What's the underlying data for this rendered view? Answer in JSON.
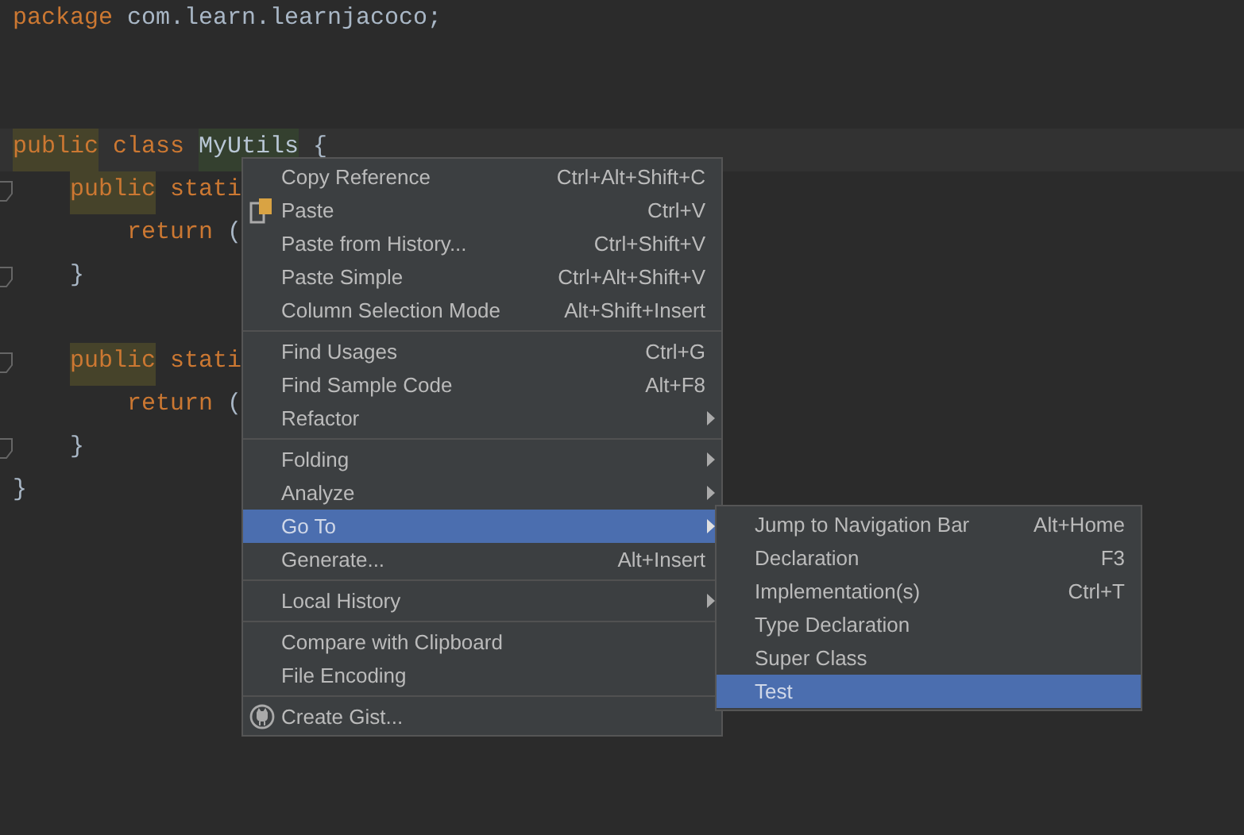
{
  "editor": {
    "lines": [
      {
        "kind": "code",
        "tokens": [
          {
            "kind": "keyword",
            "text": "package"
          },
          {
            "kind": "plain",
            "text": " com.learn.learnjacoco;"
          }
        ]
      },
      {
        "kind": "blank"
      },
      {
        "kind": "blank"
      },
      {
        "kind": "code",
        "current": true,
        "tokens": [
          {
            "kind": "keyword-marked",
            "text": "public"
          },
          {
            "kind": "keyword",
            "text": " class "
          },
          {
            "kind": "name-marked",
            "text": "MyUtils"
          },
          {
            "kind": "plain",
            "text": " {"
          }
        ],
        "children": [
          {
            "kind": "code",
            "fold": true,
            "tokens": [
              {
                "kind": "keyword-marked",
                "text": "public"
              },
              {
                "kind": "keyword",
                "text": " stati"
              }
            ],
            "children": [
              {
                "kind": "code",
                "tokens": [
                  {
                    "kind": "keyword",
                    "text": "return"
                  },
                  {
                    "kind": "plain",
                    "text": " ("
                  }
                ]
              }
            ]
          },
          {
            "kind": "code",
            "fold": true,
            "tokens": [
              {
                "kind": "plain",
                "text": "}"
              }
            ]
          },
          {
            "kind": "blank"
          },
          {
            "kind": "code",
            "fold": true,
            "tokens": [
              {
                "kind": "keyword-marked",
                "text": "public"
              },
              {
                "kind": "keyword",
                "text": " stati"
              }
            ],
            "children": [
              {
                "kind": "code",
                "tokens": [
                  {
                    "kind": "keyword",
                    "text": "return"
                  },
                  {
                    "kind": "plain",
                    "text": " ("
                  }
                ]
              }
            ]
          },
          {
            "kind": "code",
            "fold": true,
            "tokens": [
              {
                "kind": "plain",
                "text": "}"
              }
            ]
          }
        ]
      },
      {
        "kind": "code",
        "tokens": [
          {
            "kind": "plain",
            "text": "}"
          }
        ]
      }
    ]
  },
  "context_menu": {
    "sections": [
      [
        {
          "label": "Copy Reference",
          "shortcut": "Ctrl+Alt+Shift+C",
          "submenu": false,
          "selected": false
        },
        {
          "label": "Paste",
          "shortcut": "Ctrl+V",
          "submenu": false,
          "selected": false
        },
        {
          "label": "Paste from History...",
          "shortcut": "Ctrl+Shift+V",
          "submenu": false,
          "selected": false
        },
        {
          "label": "Paste Simple",
          "shortcut": "Ctrl+Alt+Shift+V",
          "submenu": false,
          "selected": false
        },
        {
          "label": "Column Selection Mode",
          "shortcut": "Alt+Shift+Insert",
          "submenu": false,
          "selected": false
        }
      ],
      [
        {
          "label": "Find Usages",
          "shortcut": "Ctrl+G",
          "submenu": false,
          "selected": false
        },
        {
          "label": "Find Sample Code",
          "shortcut": "Alt+F8",
          "submenu": false,
          "selected": false
        },
        {
          "label": "Refactor",
          "submenu": true,
          "selected": false
        }
      ],
      [
        {
          "label": "Folding",
          "submenu": true,
          "selected": false
        },
        {
          "label": "Analyze",
          "submenu": true,
          "selected": false
        },
        {
          "label": "Go To",
          "submenu": true,
          "selected": true
        },
        {
          "label": "Generate...",
          "shortcut": "Alt+Insert",
          "submenu": false,
          "selected": false
        }
      ],
      [
        {
          "label": "Local History",
          "submenu": true,
          "selected": false
        }
      ],
      [
        {
          "label": "Compare with Clipboard",
          "submenu": false,
          "selected": false
        },
        {
          "label": "File Encoding",
          "submenu": false,
          "selected": false
        }
      ],
      [
        {
          "label": "Create Gist...",
          "submenu": false,
          "selected": false
        }
      ]
    ]
  },
  "submenu": {
    "items": [
      {
        "label": "Jump to Navigation Bar",
        "shortcut": "Alt+Home",
        "selected": false
      },
      {
        "label": "Declaration",
        "shortcut": "F3",
        "selected": false
      },
      {
        "label": "Implementation(s)",
        "shortcut": "Ctrl+T",
        "selected": false
      },
      {
        "label": "Type Declaration",
        "selected": false
      },
      {
        "label": "Super Class",
        "selected": false
      },
      {
        "label": "Test",
        "selected": true
      }
    ]
  }
}
